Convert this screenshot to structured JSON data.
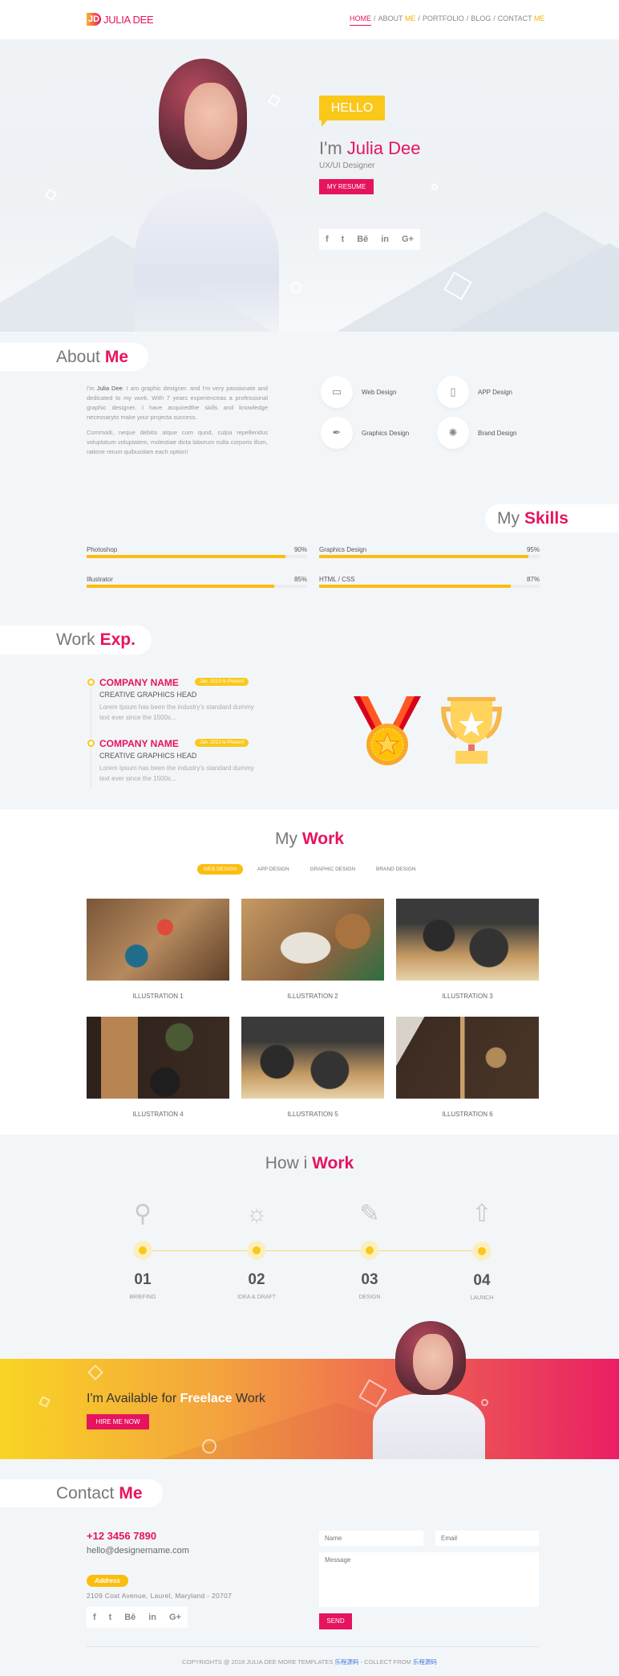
{
  "header": {
    "logo_mark": "JD",
    "logo_text": "JULIA DEE",
    "nav": [
      {
        "label": "HOME",
        "accent": ""
      },
      {
        "label": "ABOUT ",
        "accent": "ME"
      },
      {
        "label": "PORTFOLIO",
        "accent": ""
      },
      {
        "label": "BLOG",
        "accent": ""
      },
      {
        "label": "CONTACT ",
        "accent": "ME"
      }
    ],
    "separator": "/"
  },
  "hero": {
    "hello": "HELLO",
    "greeting": "I'm",
    "name": "Julia Dee",
    "role": "UX/UI Designer",
    "resume_button": "MY RESUME",
    "social": [
      "f",
      "t",
      "Bē",
      "in",
      "G+"
    ]
  },
  "about": {
    "title_light": "About",
    "title_bold": "Me",
    "p1_pre": "I'm ",
    "p1_name": "Julia Dee",
    "p1_post": ". I am graphic designer. and I'm very passionate and dedicated to my work. With 7 years experienceas a professional graphic designer, I have acquiredthe skills and knowledge necessaryto make your projecta success.",
    "p2": "Commodi, neque debitis atque cum quod, culpa repellendus voluptatum voluptatem, molestiae dicta laborum nulla corporis illum, ratione rerum quibusdam each option!",
    "services": [
      {
        "label": "Web Design",
        "icon": "monitor-icon"
      },
      {
        "label": "APP Design",
        "icon": "mobile-icon"
      },
      {
        "label": "Graphics Design",
        "icon": "pen-tool-icon"
      },
      {
        "label": "Brand Design",
        "icon": "lightbulb-icon"
      }
    ]
  },
  "skills": {
    "title_light": "My",
    "title_bold": "Skills",
    "items": [
      {
        "name": "Photoshop",
        "percent": 90,
        "label": "90%"
      },
      {
        "name": "Graphics Design",
        "percent": 95,
        "label": "95%"
      },
      {
        "name": "Illustrator",
        "percent": 85,
        "label": "85%"
      },
      {
        "name": "HTML / CSS",
        "percent": 87,
        "label": "87%"
      }
    ]
  },
  "work_exp": {
    "title_light": "Work",
    "title_bold": "Exp.",
    "jobs": [
      {
        "company": "COMPANY NAME",
        "date": "Jan. 2013 to Present",
        "title": "CREATIVE GRAPHICS HEAD",
        "desc": "Lorem Ipsum has been the industry's standard dummy text ever since the 1500s..."
      },
      {
        "company": "COMPANY NAME",
        "date": "Jan. 2013 to Present",
        "title": "CREATIVE GRAPHICS HEAD",
        "desc": "Lorem Ipsum has been the industry's standard dummy text ever since the 1500s..."
      }
    ]
  },
  "portfolio": {
    "title_light": "My",
    "title_bold": "Work",
    "tabs": [
      "WEB DESIGN",
      "APP DESIGN",
      "GRAPHIC DESIGN",
      "BRAND DESIGN"
    ],
    "active_tab": 0,
    "items": [
      "ILLUSTRATION 1",
      "ILLUSTRATION 2",
      "ILLUSTRATION 3",
      "ILLUSTRATION 4",
      "ILLUSTRATION 5",
      "ILLUSTRATION 6"
    ]
  },
  "process": {
    "title_light": "How i",
    "title_bold": "Work",
    "steps": [
      {
        "num": "01",
        "label": "BRIEFING",
        "icon": "magnifier-icon"
      },
      {
        "num": "02",
        "label": "IDEA & DRAFT",
        "icon": "idea-head-icon"
      },
      {
        "num": "03",
        "label": "DESIGN",
        "icon": "design-tools-icon"
      },
      {
        "num": "04",
        "label": "LAUNCH",
        "icon": "rocket-icon"
      }
    ]
  },
  "banner": {
    "pre": "I'm Available for",
    "bold": "Freelace",
    "post": "Work",
    "button": "HIRE ME NOW"
  },
  "contact": {
    "title_light": "Contact",
    "title_bold": "Me",
    "phone": "+12 3456 7890",
    "email": "hello@designername.com",
    "address_label": "Address",
    "address": "2109 Cost Avenue, Laurel, Maryland - 20707",
    "social": [
      "f",
      "t",
      "Bē",
      "in",
      "G+"
    ],
    "form": {
      "name_placeholder": "Name",
      "email_placeholder": "Email",
      "message_placeholder": "Message",
      "send": "SEND"
    }
  },
  "footer": {
    "text": "COPYRIGHTS @ 2018 JULIA DEE MORE TEMPLATES ",
    "link1": "乐程源码",
    "middle": " - COLLECT FROM ",
    "link2": "乐程源码"
  },
  "colors": {
    "accent": "#e6135f",
    "highlight": "#fbbd0e",
    "background": "#f3f6f9"
  }
}
